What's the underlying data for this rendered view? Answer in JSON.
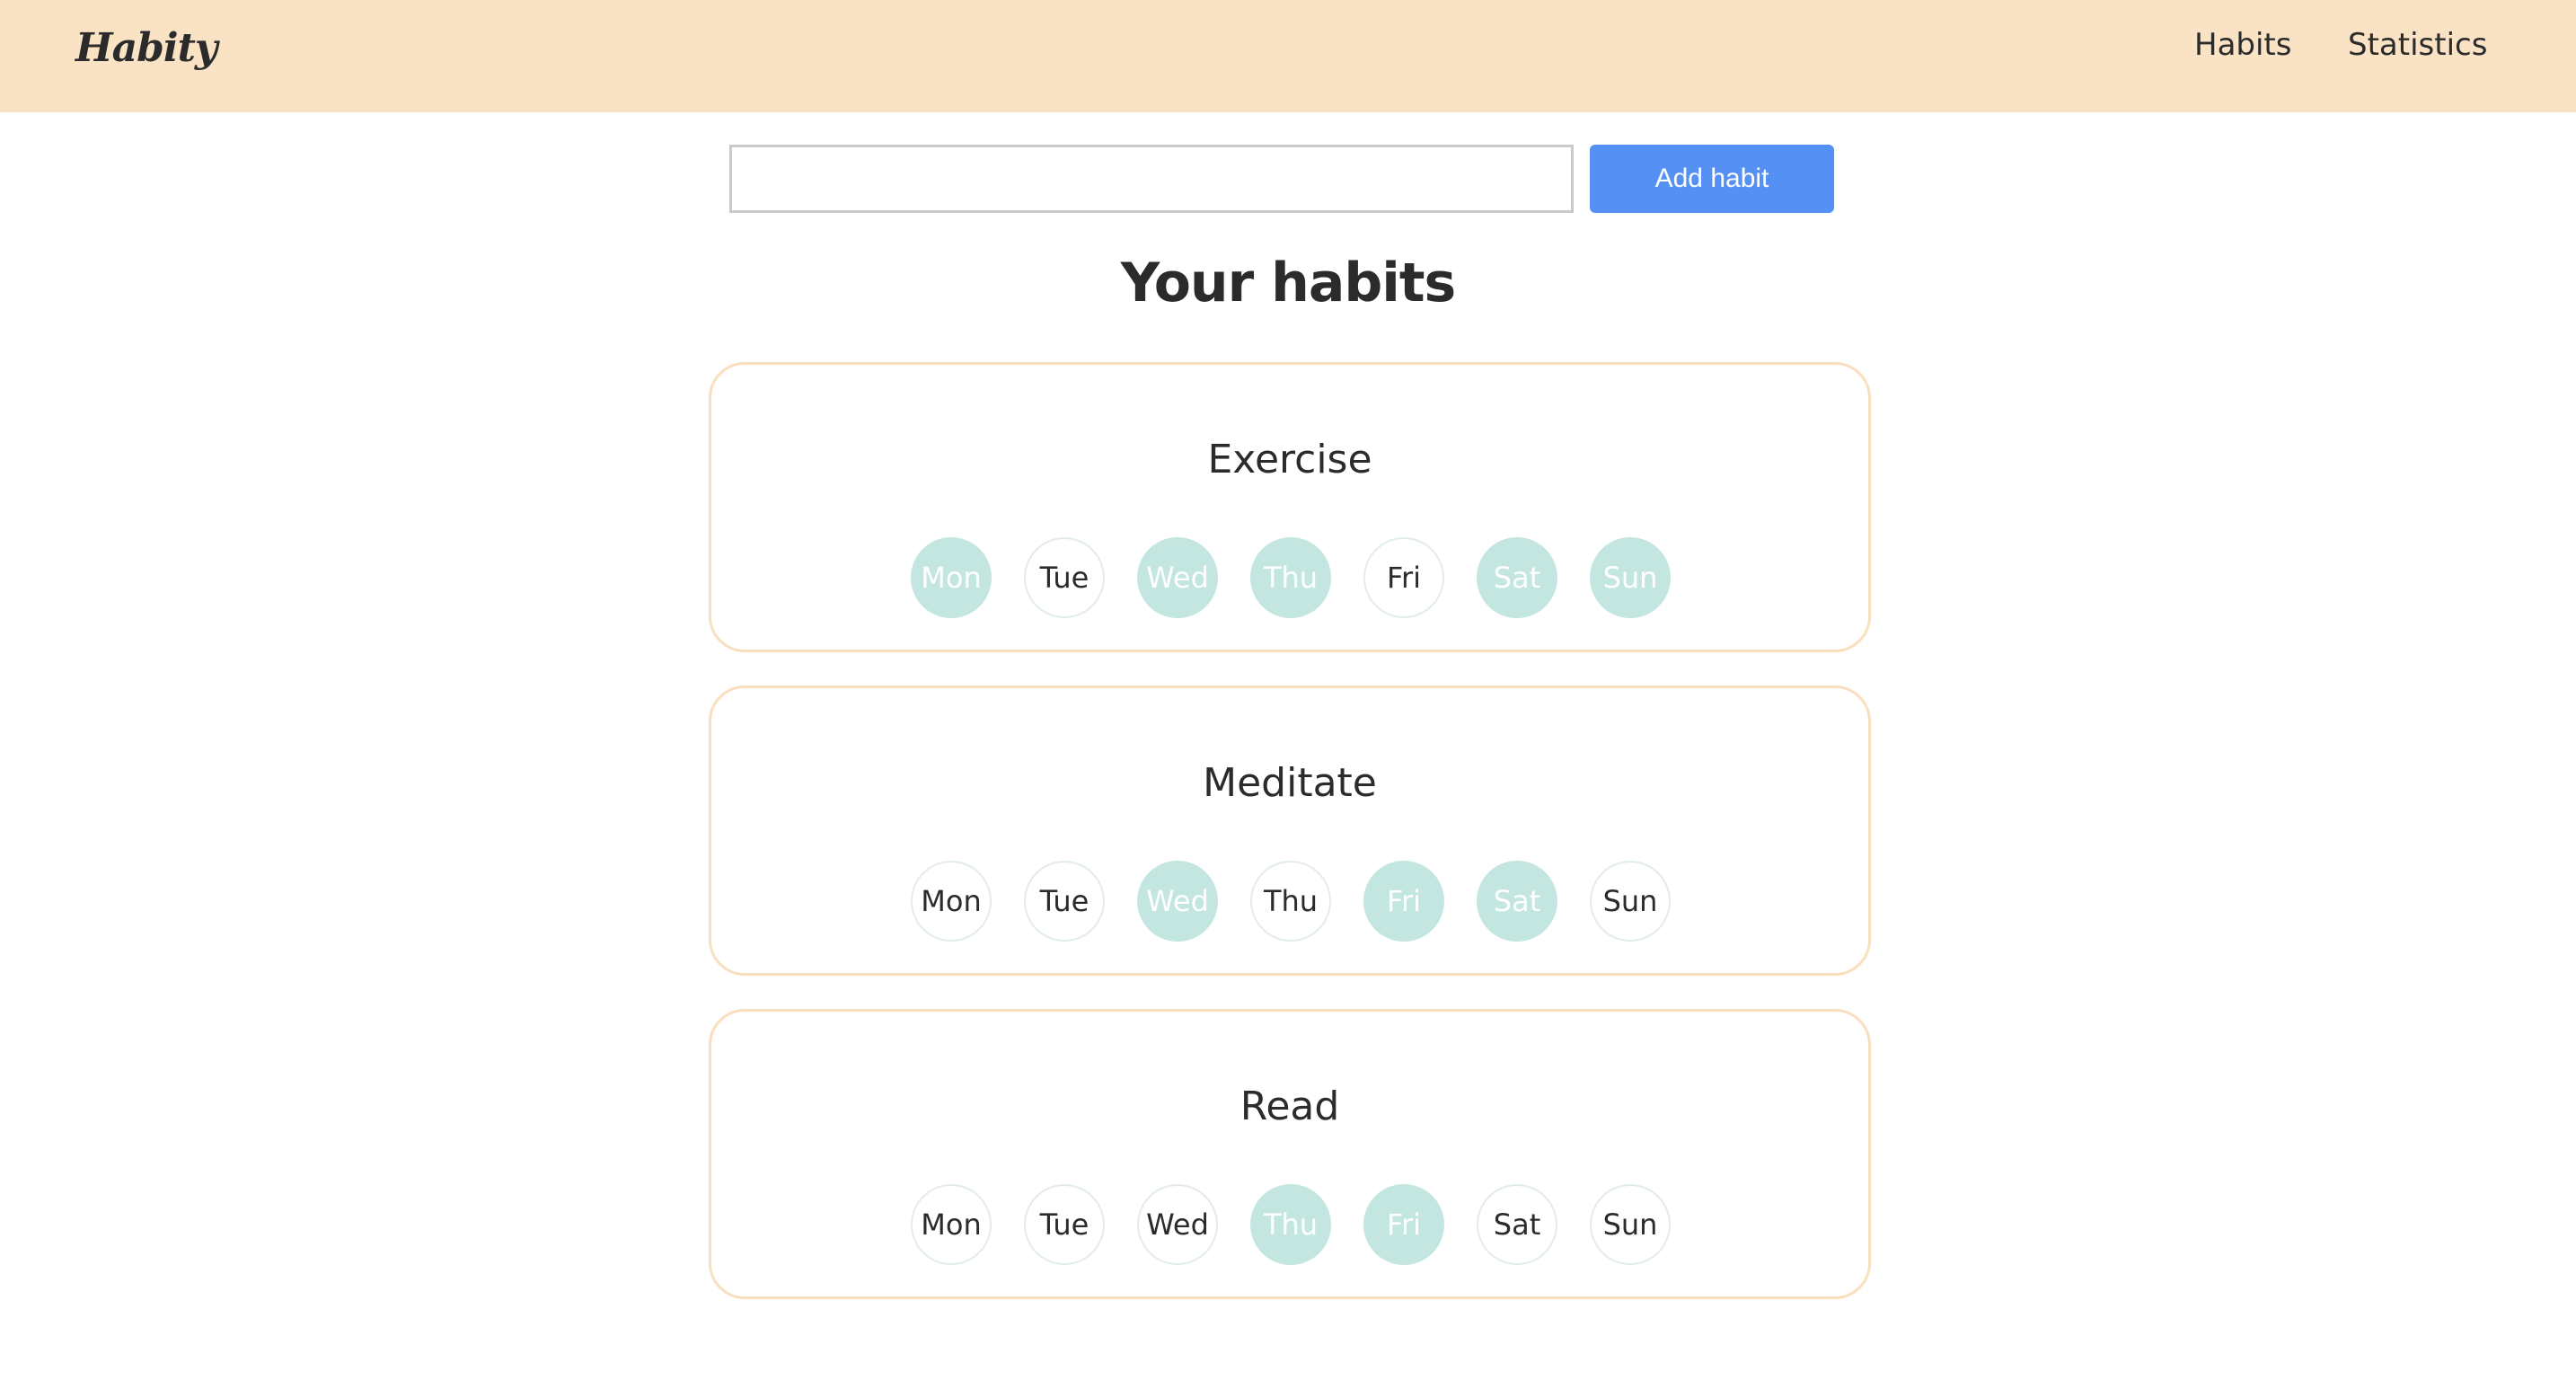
{
  "navbar": {
    "logo": "Habity",
    "links": [
      "Habits",
      "Statistics"
    ]
  },
  "form": {
    "input_value": "",
    "input_placeholder": "",
    "add_button_label": "Add habit"
  },
  "page_title": "Your habits",
  "colors": {
    "navbar_bg": "#f9e3c4",
    "card_border": "#f9dfbd",
    "button_bg": "#5590f5",
    "day_done_bg": "#c4e6e1"
  },
  "habits": [
    {
      "name": "Exercise",
      "days": [
        {
          "label": "Mon",
          "done": true
        },
        {
          "label": "Tue",
          "done": false
        },
        {
          "label": "Wed",
          "done": true
        },
        {
          "label": "Thu",
          "done": true
        },
        {
          "label": "Fri",
          "done": false
        },
        {
          "label": "Sat",
          "done": true
        },
        {
          "label": "Sun",
          "done": true
        }
      ]
    },
    {
      "name": "Meditate",
      "days": [
        {
          "label": "Mon",
          "done": false
        },
        {
          "label": "Tue",
          "done": false
        },
        {
          "label": "Wed",
          "done": true
        },
        {
          "label": "Thu",
          "done": false
        },
        {
          "label": "Fri",
          "done": true
        },
        {
          "label": "Sat",
          "done": true
        },
        {
          "label": "Sun",
          "done": false
        }
      ]
    },
    {
      "name": "Read",
      "days": [
        {
          "label": "Mon",
          "done": false
        },
        {
          "label": "Tue",
          "done": false
        },
        {
          "label": "Wed",
          "done": false
        },
        {
          "label": "Thu",
          "done": true
        },
        {
          "label": "Fri",
          "done": true
        },
        {
          "label": "Sat",
          "done": false
        },
        {
          "label": "Sun",
          "done": false
        }
      ]
    }
  ]
}
